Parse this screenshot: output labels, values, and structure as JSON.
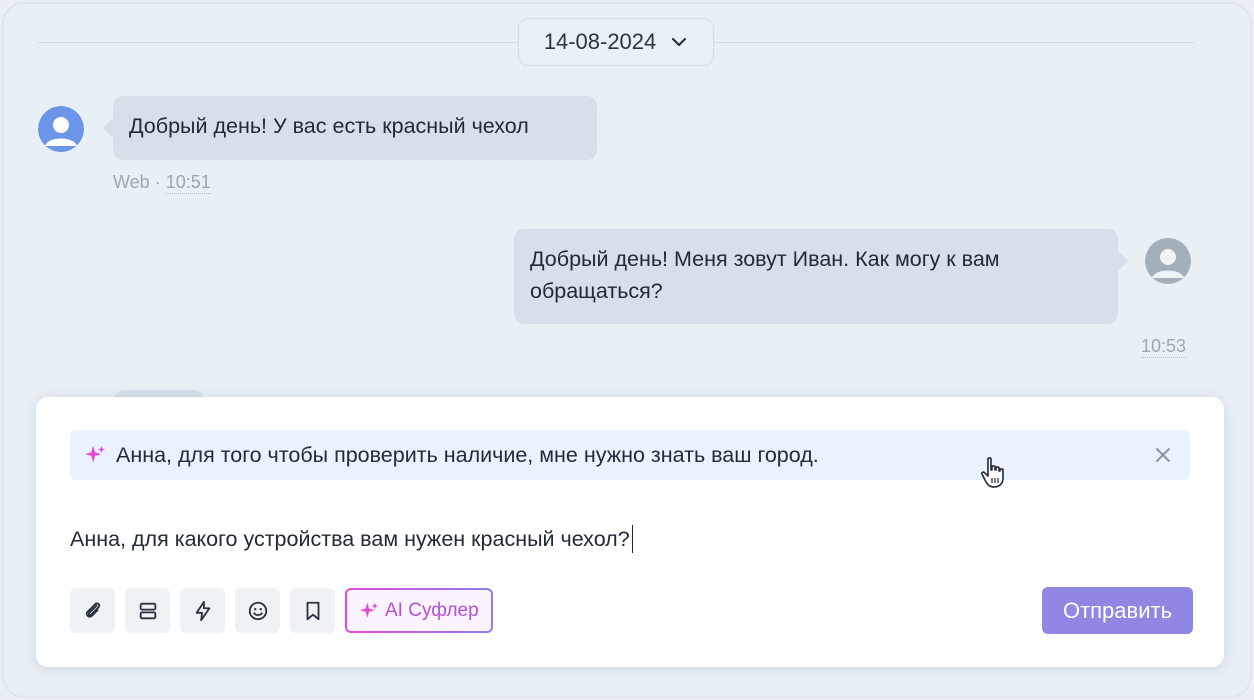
{
  "date_selector": {
    "value": "14-08-2024",
    "icon": "chevron-down-icon"
  },
  "messages": [
    {
      "direction": "incoming",
      "text": "Добрый день! У вас есть красный чехол",
      "channel": "Web",
      "separator": "·",
      "time": "10:51"
    },
    {
      "direction": "outgoing",
      "text_line1": "Добрый день! Меня зовут Иван. Как могу к вам",
      "text_line2": "обращаться?",
      "time": "10:53"
    }
  ],
  "composer": {
    "suggestion": {
      "text": "Анна, для того чтобы проверить наличие, мне нужно знать ваш город.",
      "icon": "sparkle-icon",
      "close_icon": "close-icon"
    },
    "input_value": "Анна, для какого устройства вам нужен красный чехол?",
    "toolbar": {
      "tools": [
        "paperclip-icon",
        "template-icon",
        "lightning-icon",
        "emoji-icon",
        "bookmark-icon"
      ],
      "ai_label": "AI Суфлер"
    },
    "send_label": "Отправить"
  },
  "colors": {
    "background": "#e9f0f5",
    "bubble": "#d5e0ea",
    "send_button": "#8f87e3",
    "ai_accent": "#e548d8",
    "suggestion_bg": "#eaf2fd"
  }
}
